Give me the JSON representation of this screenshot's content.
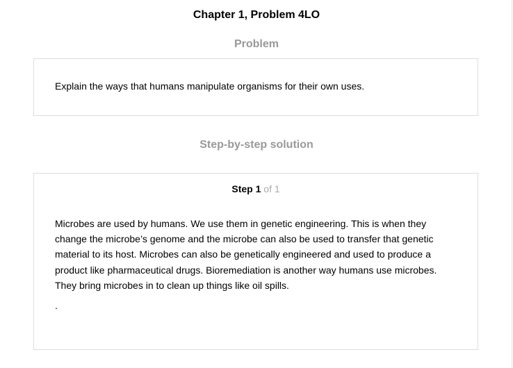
{
  "header": {
    "title": "Chapter 1, Problem 4LO"
  },
  "problem": {
    "heading": "Problem",
    "text": "Explain the ways that humans manipulate organisms for their own uses."
  },
  "solution": {
    "heading": "Step-by-step solution",
    "step": {
      "word": "Step",
      "number": "1",
      "of_text": "of 1"
    },
    "body": "Microbes are used by humans. We use them in genetic engineering. This is when they change the microbe’s genome and the microbe can also be used to transfer that genetic material to its host. Microbes can also be genetically engineered and used to produce a product like pharmaceutical drugs. Bioremediation is another way humans use microbes. They bring microbes in to clean up things like oil spills.",
    "trailing": "."
  },
  "colors": {
    "heading_gray": "#999999",
    "border": "#dcdcdc",
    "muted": "#aaaaaa"
  }
}
